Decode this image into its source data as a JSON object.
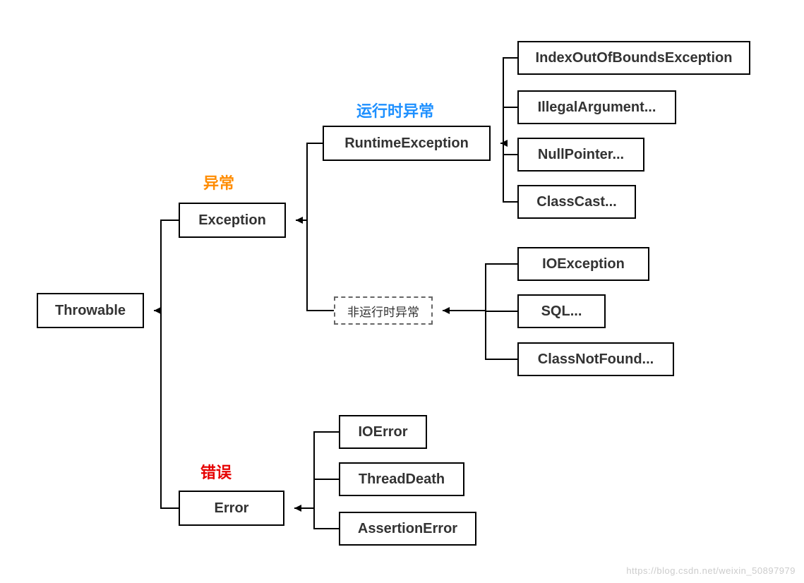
{
  "annotations": {
    "runtime": "运行时异常",
    "exception_label": "异常",
    "error_label": "错误"
  },
  "nodes": {
    "throwable": "Throwable",
    "exception": "Exception",
    "error": "Error",
    "runtime_exception": "RuntimeException",
    "non_runtime": "非运行时异常",
    "index_oob": "IndexOutOfBoundsException",
    "illegal_arg": "IllegalArgument...",
    "null_pointer": "NullPointer...",
    "class_cast": "ClassCast...",
    "io_exception": "IOException",
    "sql_exception": "SQL...",
    "class_not_found": "ClassNotFound...",
    "io_error": "IOError",
    "thread_death": "ThreadDeath",
    "assertion_error": "AssertionError"
  },
  "watermark": "https://blog.csdn.net/weixin_50897979"
}
